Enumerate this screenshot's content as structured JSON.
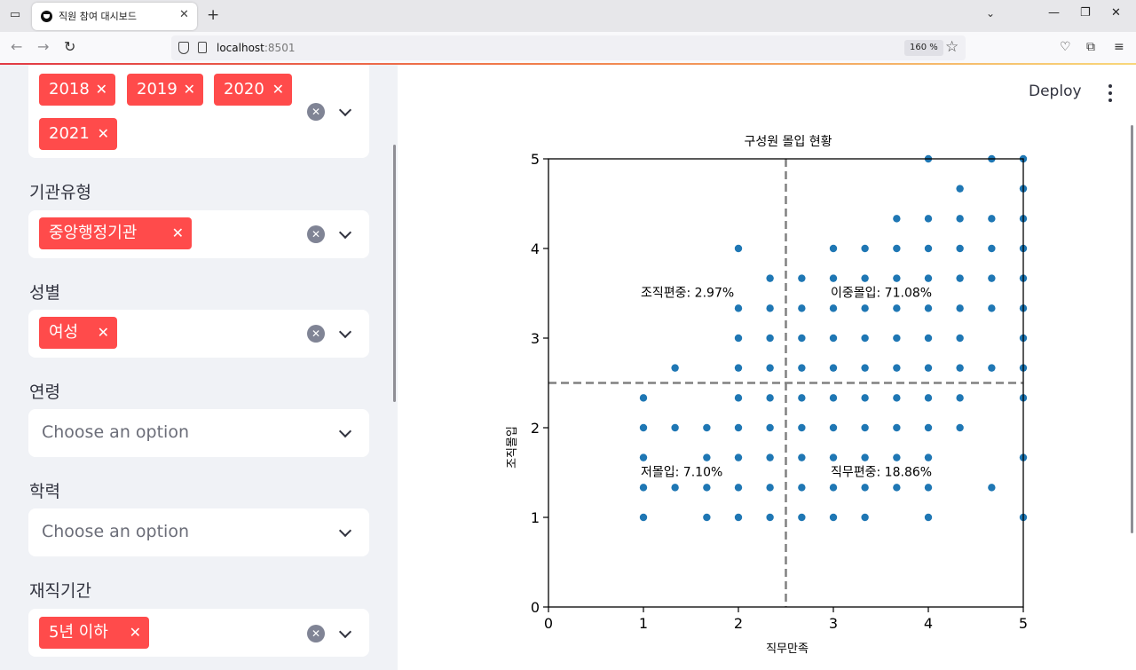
{
  "browser": {
    "tab_title": "직원 참여 대시보드",
    "url_host": "localhost",
    "url_port": ":8501",
    "zoom": "160 %"
  },
  "sidebar": {
    "year_chips": [
      "2018",
      "2019",
      "2020",
      "2021"
    ],
    "org_type": {
      "label": "기관유형",
      "chips": [
        "중앙행정기관"
      ]
    },
    "gender": {
      "label": "성별",
      "chips": [
        "여성"
      ]
    },
    "age": {
      "label": "연령",
      "placeholder": "Choose an option"
    },
    "education": {
      "label": "학력",
      "placeholder": "Choose an option"
    },
    "tenure": {
      "label": "재직기간",
      "chips": [
        "5년 이하"
      ]
    },
    "chip_color": "#ff4b4b"
  },
  "main": {
    "deploy_label": "Deploy"
  },
  "chart_data": {
    "type": "scatter",
    "title": "구성원 몰입 현황",
    "xlabel": "직무만족",
    "ylabel": "조직몰입",
    "xlim": [
      0,
      5
    ],
    "ylim": [
      0,
      5
    ],
    "xticks": [
      "0",
      "1",
      "2",
      "3",
      "4",
      "5"
    ],
    "yticks": [
      "0",
      "1",
      "2",
      "3",
      "4",
      "5"
    ],
    "threshold_x": 2.5,
    "threshold_y": 2.5,
    "point_color": "#1f77b4",
    "line_color": "#808080",
    "annotations": [
      {
        "text": "조직편중: 2.97%",
        "x": 1.0,
        "y": 3.5
      },
      {
        "text": "이중몰입: 71.08%",
        "x": 3.0,
        "y": 3.5
      },
      {
        "text": "저몰입: 7.10%",
        "x": 1.0,
        "y": 1.5
      },
      {
        "text": "직무편중: 18.86%",
        "x": 3.0,
        "y": 1.5
      }
    ],
    "points": [
      [
        1,
        1
      ],
      [
        1,
        1.333
      ],
      [
        1,
        1.667
      ],
      [
        1,
        2
      ],
      [
        1,
        2.333
      ],
      [
        1.333,
        1.333
      ],
      [
        1.333,
        2
      ],
      [
        1.333,
        2.667
      ],
      [
        1.667,
        1
      ],
      [
        1.667,
        1.333
      ],
      [
        1.667,
        1.667
      ],
      [
        1.667,
        2
      ],
      [
        2,
        1
      ],
      [
        2,
        1.333
      ],
      [
        2,
        1.667
      ],
      [
        2,
        2
      ],
      [
        2,
        2.333
      ],
      [
        2,
        2.667
      ],
      [
        2,
        3
      ],
      [
        2,
        3.333
      ],
      [
        2,
        4
      ],
      [
        2.333,
        1
      ],
      [
        2.333,
        1.333
      ],
      [
        2.333,
        1.667
      ],
      [
        2.333,
        2
      ],
      [
        2.333,
        2.333
      ],
      [
        2.333,
        2.667
      ],
      [
        2.333,
        3
      ],
      [
        2.333,
        3.333
      ],
      [
        2.333,
        3.667
      ],
      [
        2.667,
        1
      ],
      [
        2.667,
        1.333
      ],
      [
        2.667,
        1.667
      ],
      [
        2.667,
        2
      ],
      [
        2.667,
        2.333
      ],
      [
        2.667,
        2.667
      ],
      [
        2.667,
        3
      ],
      [
        2.667,
        3.333
      ],
      [
        2.667,
        3.667
      ],
      [
        3,
        1
      ],
      [
        3,
        1.333
      ],
      [
        3,
        1.667
      ],
      [
        3,
        2
      ],
      [
        3,
        2.333
      ],
      [
        3,
        2.667
      ],
      [
        3,
        3
      ],
      [
        3,
        3.333
      ],
      [
        3,
        3.667
      ],
      [
        3,
        4
      ],
      [
        3.333,
        1
      ],
      [
        3.333,
        1.333
      ],
      [
        3.333,
        1.667
      ],
      [
        3.333,
        2
      ],
      [
        3.333,
        2.333
      ],
      [
        3.333,
        2.667
      ],
      [
        3.333,
        3
      ],
      [
        3.333,
        3.333
      ],
      [
        3.333,
        3.667
      ],
      [
        3.333,
        4
      ],
      [
        3.667,
        1.333
      ],
      [
        3.667,
        1.667
      ],
      [
        3.667,
        2
      ],
      [
        3.667,
        2.333
      ],
      [
        3.667,
        2.667
      ],
      [
        3.667,
        3
      ],
      [
        3.667,
        3.333
      ],
      [
        3.667,
        3.667
      ],
      [
        3.667,
        4
      ],
      [
        3.667,
        4.333
      ],
      [
        4,
        1
      ],
      [
        4,
        1.333
      ],
      [
        4,
        1.667
      ],
      [
        4,
        2
      ],
      [
        4,
        2.333
      ],
      [
        4,
        2.667
      ],
      [
        4,
        3
      ],
      [
        4,
        3.333
      ],
      [
        4,
        3.667
      ],
      [
        4,
        4
      ],
      [
        4,
        4.333
      ],
      [
        4,
        5
      ],
      [
        4.333,
        2
      ],
      [
        4.333,
        2.333
      ],
      [
        4.333,
        2.667
      ],
      [
        4.333,
        3
      ],
      [
        4.333,
        3.333
      ],
      [
        4.333,
        3.667
      ],
      [
        4.333,
        4
      ],
      [
        4.333,
        4.333
      ],
      [
        4.333,
        4.667
      ],
      [
        4.667,
        1.333
      ],
      [
        4.667,
        2.667
      ],
      [
        4.667,
        3.333
      ],
      [
        4.667,
        3.667
      ],
      [
        4.667,
        4
      ],
      [
        4.667,
        4.333
      ],
      [
        4.667,
        5
      ],
      [
        5,
        1
      ],
      [
        5,
        1.667
      ],
      [
        5,
        2.333
      ],
      [
        5,
        2.667
      ],
      [
        5,
        3
      ],
      [
        5,
        3.333
      ],
      [
        5,
        3.667
      ],
      [
        5,
        4
      ],
      [
        5,
        4.333
      ],
      [
        5,
        4.667
      ],
      [
        5,
        5
      ]
    ]
  }
}
